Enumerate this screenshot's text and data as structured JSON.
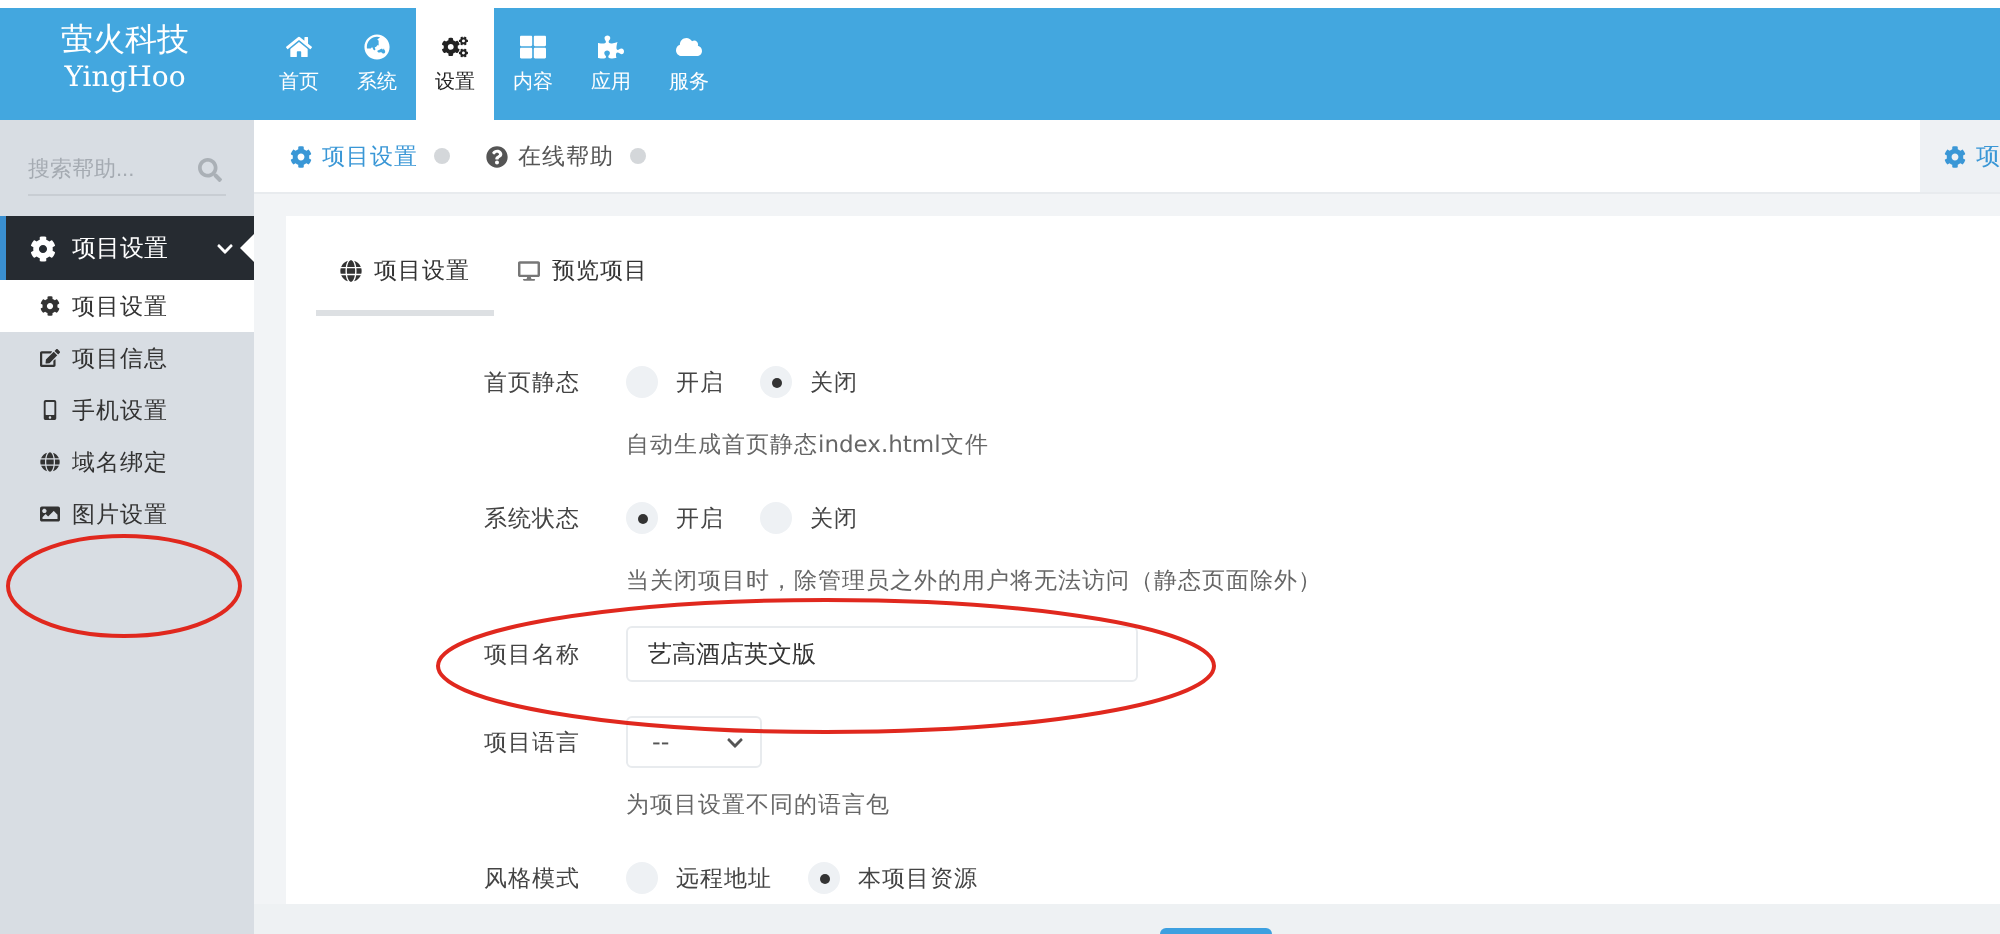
{
  "header": {
    "logo_title": "萤火科技",
    "logo_subtitle": "YingHoo",
    "nav": [
      {
        "label": "首页",
        "selected": false
      },
      {
        "label": "系统",
        "selected": false
      },
      {
        "label": "设置",
        "selected": true
      },
      {
        "label": "内容",
        "selected": false
      },
      {
        "label": "应用",
        "selected": false
      },
      {
        "label": "服务",
        "selected": false
      }
    ]
  },
  "sidebar": {
    "search": {
      "placeholder": "搜索帮助..."
    },
    "section": {
      "label": "项目设置",
      "expanded": true
    },
    "items": [
      {
        "label": "项目设置",
        "selected": true
      },
      {
        "label": "项目信息",
        "selected": false
      },
      {
        "label": "手机设置",
        "selected": false
      },
      {
        "label": "域名绑定",
        "selected": false
      },
      {
        "label": "图片设置",
        "selected": false
      }
    ]
  },
  "breadcrumb": [
    {
      "label": "项目设置",
      "selected": true
    },
    {
      "label": "在线帮助",
      "selected": false
    }
  ],
  "right_tab": {
    "label": "项"
  },
  "tabs": [
    {
      "label": "项目设置",
      "selected": true
    },
    {
      "label": "预览项目",
      "selected": false
    }
  ],
  "form": {
    "fields": [
      {
        "kind": "radio",
        "label": "首页静态",
        "options": [
          {
            "label": "开启",
            "selected": false
          },
          {
            "label": "关闭",
            "selected": true
          }
        ],
        "help": "自动生成首页静态index.html文件"
      },
      {
        "kind": "radio",
        "label": "系统状态",
        "options": [
          {
            "label": "开启",
            "selected": true
          },
          {
            "label": "关闭",
            "selected": false
          }
        ],
        "help": "当关闭项目时，除管理员之外的用户将无法访问（静态页面除外）"
      },
      {
        "kind": "text",
        "label": "项目名称",
        "value": "艺高酒店英文版"
      },
      {
        "kind": "select",
        "label": "项目语言",
        "value": "--",
        "help": "为项目设置不同的语言包"
      },
      {
        "kind": "radio",
        "label": "风格模式",
        "options": [
          {
            "label": "远程地址",
            "selected": false
          },
          {
            "label": "本项目资源",
            "selected": true
          }
        ]
      }
    ]
  }
}
